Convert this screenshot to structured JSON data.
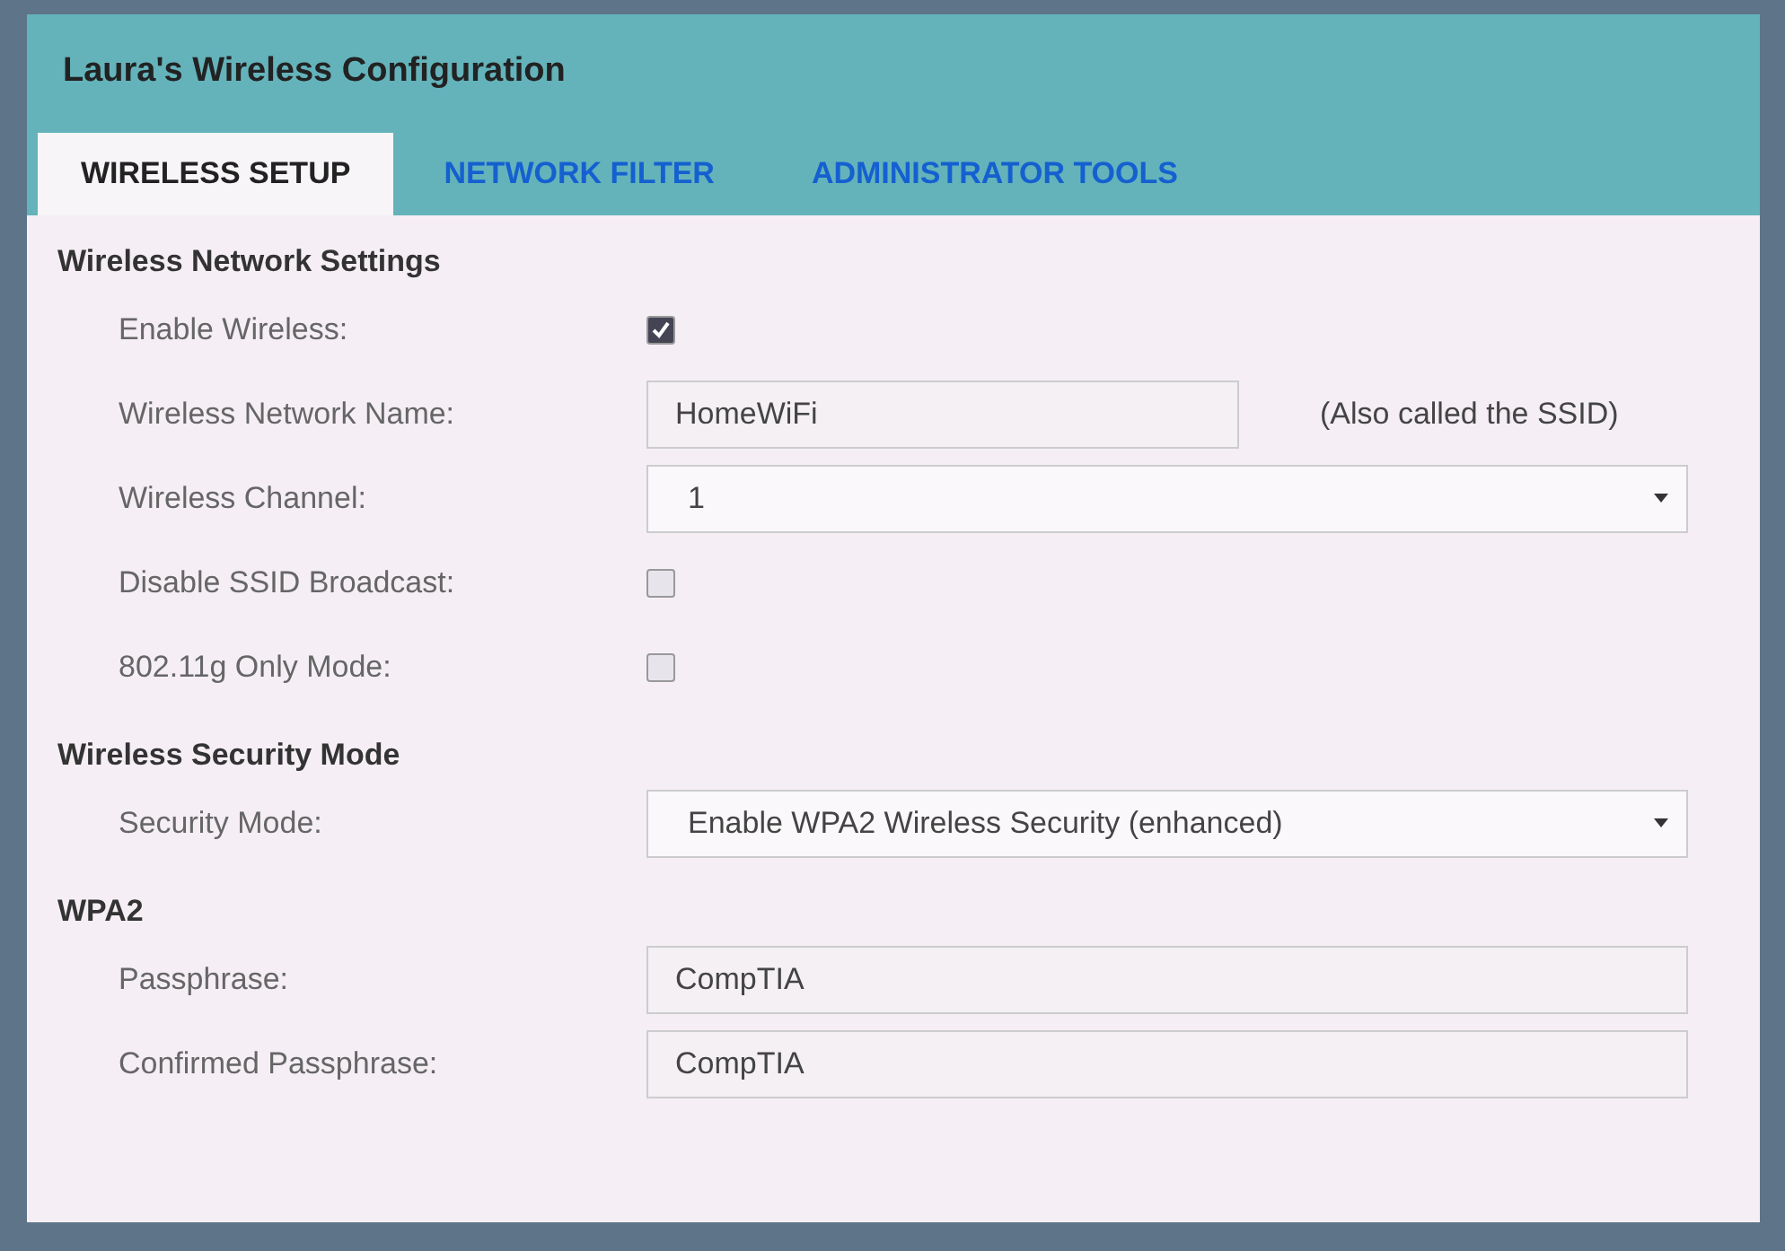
{
  "window": {
    "title": "Laura's Wireless Configuration"
  },
  "tabs": [
    {
      "label": "WIRELESS SETUP",
      "selected": true
    },
    {
      "label": "NETWORK FILTER",
      "selected": false
    },
    {
      "label": "ADMINISTRATOR TOOLS",
      "selected": false
    }
  ],
  "sections": [
    {
      "heading": "Wireless Network Settings",
      "rows": [
        {
          "kind": "checkbox",
          "label": "Enable Wireless:",
          "checked": true
        },
        {
          "kind": "text",
          "label": "Wireless Network Name:",
          "value": "HomeWiFi",
          "note": "(Also called the SSID)"
        },
        {
          "kind": "select",
          "label": "Wireless Channel:",
          "value": "1"
        },
        {
          "kind": "checkbox",
          "label": "Disable SSID Broadcast:",
          "checked": false
        },
        {
          "kind": "checkbox",
          "label": "802.11g Only Mode:",
          "checked": false
        }
      ]
    },
    {
      "heading": "Wireless Security Mode",
      "rows": [
        {
          "kind": "select",
          "label": "Security Mode:",
          "value": "Enable WPA2 Wireless Security (enhanced)"
        }
      ]
    },
    {
      "heading": "WPA2",
      "rows": [
        {
          "kind": "text",
          "label": "Passphrase:",
          "value": "CompTIA"
        },
        {
          "kind": "text",
          "label": "Confirmed Passphrase:",
          "value": "CompTIA"
        }
      ]
    }
  ]
}
